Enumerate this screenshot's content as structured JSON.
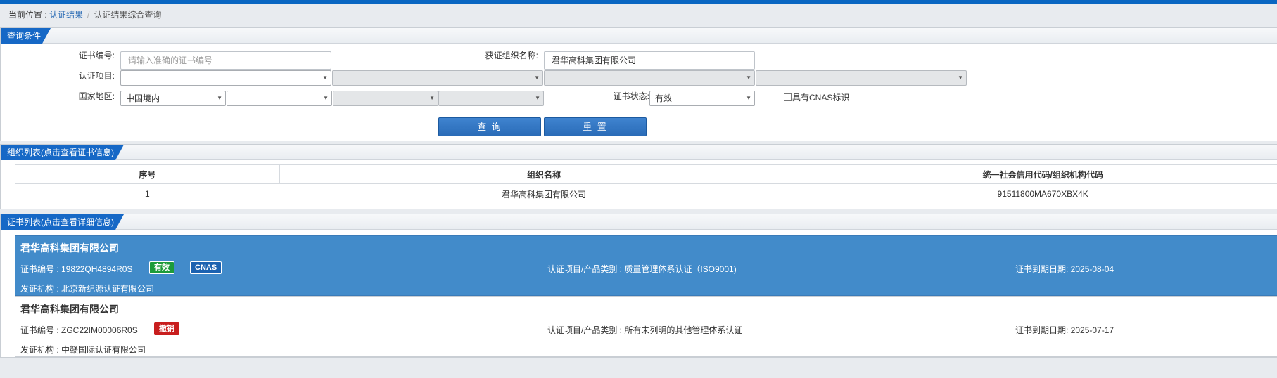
{
  "breadcrumb": {
    "prefix": "当前位置 : ",
    "link": "认证结果",
    "sep": "/",
    "current": "认证结果综合查询"
  },
  "query": {
    "panel_title": "查询条件",
    "cert_no_label": "证书编号:",
    "cert_no_placeholder": "请输入准确的证书编号",
    "cert_no_value": "",
    "org_name_label": "获证组织名称:",
    "org_name_value": "君华高科集团有限公司",
    "project_label": "认证项目:",
    "project_selects": [
      "",
      "",
      "",
      ""
    ],
    "region_label": "国家地区:",
    "region_selects": [
      "中国境内",
      "",
      "",
      ""
    ],
    "status_label": "证书状态:",
    "status_value": "有效",
    "cnas_label": "具有CNAS标识",
    "cnas_checked": false,
    "search_button": "查 询",
    "reset_button": "重 置"
  },
  "org_list": {
    "panel_title": "组织列表(点击查看证书信息)",
    "columns": [
      "序号",
      "组织名称",
      "统一社会信用代码/组织机构代码"
    ],
    "rows": [
      [
        "1",
        "君华高科集团有限公司",
        "91511800MA670XBX4K"
      ]
    ]
  },
  "cert_list": {
    "panel_title": "证书列表(点击查看详细信息)",
    "cards": [
      {
        "title": "君华高科集团有限公司",
        "cert_no": "证书编号 : 19822QH4894R0S",
        "badges": [
          {
            "text": "有效",
            "color": "#1d9b3a"
          },
          {
            "text": "CNAS",
            "color": "#1b62b0"
          }
        ],
        "project": "认证项目/产品类别 : 质量管理体系认证（ISO9001)",
        "expiry": "证书到期日期: 2025-08-04",
        "issuer": "发证机构 : 北京新纪源认证有限公司",
        "active": true
      },
      {
        "title": "君华高科集团有限公司",
        "cert_no": "证书编号 : ZGC22IM00006R0S",
        "badges": [
          {
            "text": "撤销",
            "color": "#c81e1e"
          }
        ],
        "project": "认证项目/产品类别 : 所有未列明的其他管理体系认证",
        "expiry": "证书到期日期: 2025-07-17",
        "issuer": "发证机构 : 中赣国际认证有限公司",
        "active": false
      }
    ]
  }
}
